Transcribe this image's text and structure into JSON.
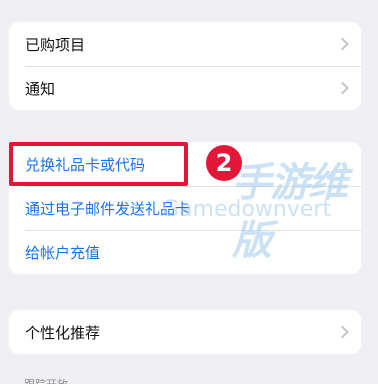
{
  "group1": {
    "items": [
      {
        "label": "已购项目"
      },
      {
        "label": "通知"
      }
    ]
  },
  "group2": {
    "items": [
      {
        "label": "兑换礼品卡或代码"
      },
      {
        "label": "通过电子邮件发送礼品卡"
      },
      {
        "label": "给帐户充值"
      }
    ]
  },
  "group3": {
    "items": [
      {
        "label": "个性化推荐"
      }
    ]
  },
  "annotation": {
    "step_number": "2",
    "highlight_color": "#e3163a"
  },
  "watermark": {
    "logo": "手游维版",
    "text": "Gamedownvert"
  },
  "bottom_peek": "跟踪开放"
}
